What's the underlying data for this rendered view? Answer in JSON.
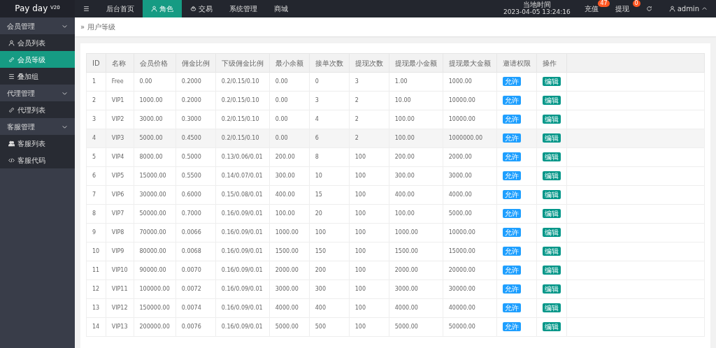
{
  "topbar": {
    "logo": "Pay day $^{V20}$",
    "nav": [
      {
        "label": "后台首页",
        "selected": false
      },
      {
        "label": "角色",
        "selected": true
      },
      {
        "label": "交易",
        "selected": false
      },
      {
        "label": "系统管理",
        "selected": false
      },
      {
        "label": "商城",
        "selected": false
      }
    ],
    "clock": {
      "label": "当地时间",
      "value": "2023-04-05 13:24:16"
    },
    "counters": [
      {
        "label": "充值",
        "count": "47"
      },
      {
        "label": "提现",
        "count": "0"
      }
    ],
    "user": "admin"
  },
  "sidebar": {
    "groups": [
      {
        "label": "会员管理",
        "expanded": true,
        "items": [
          {
            "label": "会员列表",
            "selected": false
          },
          {
            "label": "会员等级",
            "selected": true
          },
          {
            "label": "叠加组",
            "selected": false
          }
        ]
      },
      {
        "label": "代理管理",
        "expanded": true,
        "items": [
          {
            "label": "代理列表",
            "selected": false
          }
        ]
      },
      {
        "label": "客服管理",
        "expanded": true,
        "items": [
          {
            "label": "客服列表",
            "selected": false
          },
          {
            "label": "客服代码",
            "selected": false
          }
        ]
      }
    ]
  },
  "breadcrumb": {
    "separator": "»",
    "current": "用户等级"
  },
  "table": {
    "columns": [
      "ID",
      "名称",
      "会员价格",
      "佣金比例",
      "下级佣金比例",
      "最小余额",
      "接单次数",
      "提现次数",
      "提现最小金额",
      "提现最大金额",
      "邀请权限",
      "操作"
    ],
    "rows": [
      {
        "cells": [
          "1",
          "Free",
          "0.00",
          "0.2000",
          "0.2/0.15/0.10",
          "0.00",
          "0",
          "3",
          "1.00",
          "1000.00"
        ],
        "invite": "允许",
        "action": "编辑"
      },
      {
        "cells": [
          "2",
          "VIP1",
          "1000.00",
          "0.2000",
          "0.2/0.15/0.10",
          "0.00",
          "3",
          "2",
          "10.00",
          "10000.00"
        ],
        "invite": "允许",
        "action": "编辑"
      },
      {
        "cells": [
          "3",
          "VIP2",
          "3000.00",
          "0.3000",
          "0.2/0.15/0.10",
          "0.00",
          "4",
          "2",
          "100.00",
          "10000.00"
        ],
        "invite": "允许",
        "action": "编辑"
      },
      {
        "cells": [
          "4",
          "VIP3",
          "5000.00",
          "0.4500",
          "0.2/0.15/0.10",
          "0.00",
          "6",
          "2",
          "100.00",
          "1000000.00"
        ],
        "invite": "允许",
        "action": "编辑"
      },
      {
        "cells": [
          "5",
          "VIP4",
          "8000.00",
          "0.5000",
          "0.13/0.06/0.01",
          "200.00",
          "8",
          "100",
          "200.00",
          "2000.00"
        ],
        "invite": "允许",
        "action": "编辑"
      },
      {
        "cells": [
          "6",
          "VIP5",
          "15000.00",
          "0.5500",
          "0.14/0.07/0.01",
          "300.00",
          "10",
          "100",
          "300.00",
          "3000.00"
        ],
        "invite": "允许",
        "action": "编辑"
      },
      {
        "cells": [
          "7",
          "VIP6",
          "30000.00",
          "0.6000",
          "0.15/0.08/0.01",
          "400.00",
          "15",
          "100",
          "400.00",
          "4000.00"
        ],
        "invite": "允许",
        "action": "编辑"
      },
      {
        "cells": [
          "8",
          "VIP7",
          "50000.00",
          "0.7000",
          "0.16/0.09/0.01",
          "100.00",
          "20",
          "100",
          "100.00",
          "5000.00"
        ],
        "invite": "允许",
        "action": "编辑"
      },
      {
        "cells": [
          "9",
          "VIP8",
          "70000.00",
          "0.0066",
          "0.16/0.09/0.01",
          "1000.00",
          "100",
          "100",
          "1000.00",
          "10000.00"
        ],
        "invite": "允许",
        "action": "编辑"
      },
      {
        "cells": [
          "10",
          "VIP9",
          "80000.00",
          "0.0068",
          "0.16/0.09/0.01",
          "1500.00",
          "150",
          "100",
          "1500.00",
          "15000.00"
        ],
        "invite": "允许",
        "action": "编辑"
      },
      {
        "cells": [
          "11",
          "VIP10",
          "90000.00",
          "0.0070",
          "0.16/0.09/0.01",
          "2000.00",
          "200",
          "100",
          "2000.00",
          "20000.00"
        ],
        "invite": "允许",
        "action": "编辑"
      },
      {
        "cells": [
          "12",
          "VIP11",
          "100000.00",
          "0.0072",
          "0.16/0.09/0.01",
          "3000.00",
          "300",
          "100",
          "3000.00",
          "30000.00"
        ],
        "invite": "允许",
        "action": "编辑"
      },
      {
        "cells": [
          "13",
          "VIP12",
          "150000.00",
          "0.0074",
          "0.16/0.09/0.01",
          "4000.00",
          "400",
          "100",
          "4000.00",
          "40000.00"
        ],
        "invite": "允许",
        "action": "编辑"
      },
      {
        "cells": [
          "14",
          "VIP13",
          "200000.00",
          "0.0076",
          "0.16/0.09/0.01",
          "5000.00",
          "500",
          "100",
          "5000.00",
          "50000.00"
        ],
        "invite": "允许",
        "action": "编辑"
      }
    ]
  }
}
